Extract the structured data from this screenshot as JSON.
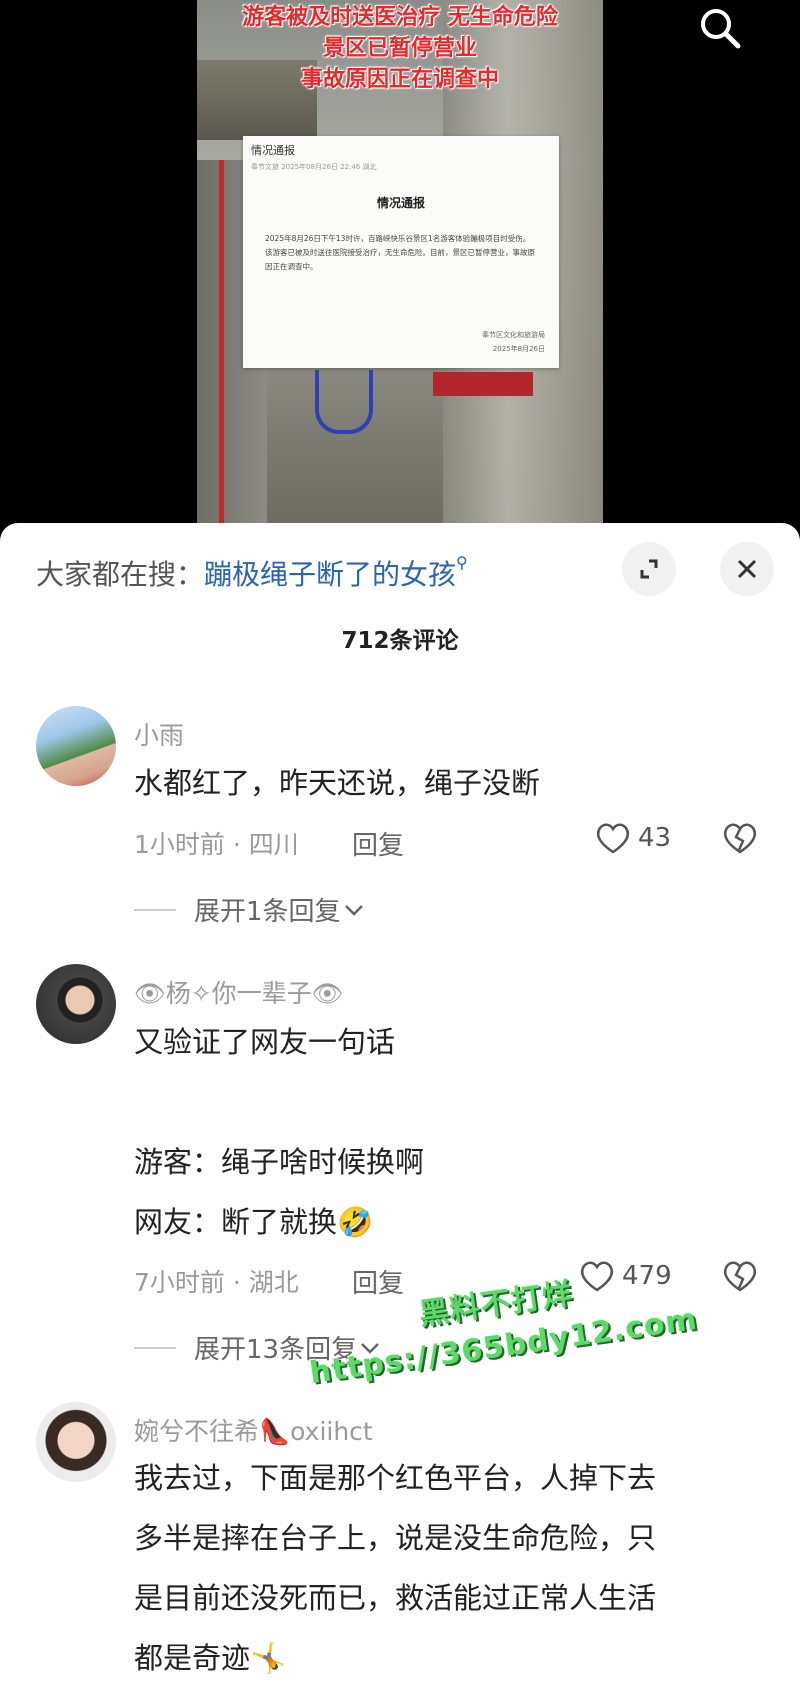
{
  "video": {
    "headline": [
      "游客被及时送医治疗 无生命危险",
      "景区已暂停营业",
      "事故原因正在调查中"
    ],
    "notice": {
      "tab_title": "情况通报",
      "meta": "奉节文旅  2025年08月26日 22:46  湖北",
      "heading": "情况通报",
      "body": "2025年8月26日下午13时许，百路峡快乐谷景区1名游客体验蹦极项目时受伤。该游客已被及时送往医院接受治疗，无生命危险。目前，景区已暂停营业，事故原因正在调查中。",
      "signature": "奉节区文化和旅游局",
      "date": "2025年8月26日"
    },
    "search_icon": "search-icon"
  },
  "sheet": {
    "trending_prefix": "大家都在搜：",
    "trending_query": "蹦极绳子断了的女孩",
    "comment_count": "712条评论",
    "comments": [
      {
        "user": "小雨",
        "lines": [
          "水都红了，昨天还说，绳子没断"
        ],
        "meta": "1小时前 · 四川",
        "reply": "回复",
        "likes": "43",
        "expand": "展开1条回复"
      },
      {
        "user": "👁杨✧你一辈子👁",
        "lines": [
          "又验证了网友一句话",
          "",
          "游客：绳子啥时候换啊",
          "网友：断了就换🤣"
        ],
        "meta": "7小时前 · 湖北",
        "reply": "回复",
        "likes": "479",
        "expand": "展开13条回复"
      },
      {
        "user": "婉兮不往希👠oxiihct",
        "lines": [
          "我去过，下面是那个红色平台，人掉下去",
          "多半是摔在台子上，说是没生命危险，只",
          "是目前还没死而已，救活能过正常人生活",
          "都是奇迹🤸"
        ]
      }
    ]
  },
  "watermark": {
    "line1": "黑料不打烊",
    "line2": "https://365bdy12.com"
  },
  "colors": {
    "accent": "#2b63b6",
    "headline": "#e8282b",
    "watermark": "#5fd86b"
  }
}
